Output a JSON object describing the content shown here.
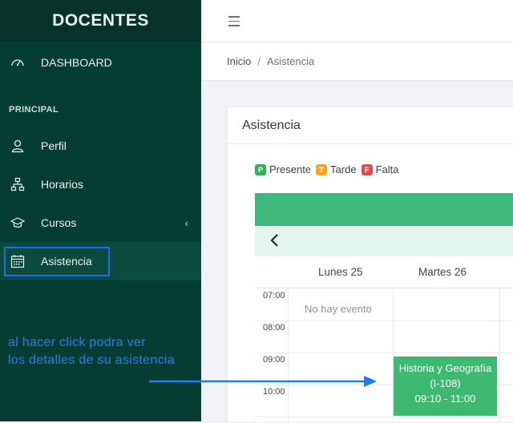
{
  "sidebar": {
    "brand": "DOCENTES",
    "dashboard": "DASHBOARD",
    "section": "PRINCIPAL",
    "items": [
      {
        "label": "Perfil",
        "icon": "user-icon"
      },
      {
        "label": "Horarios",
        "icon": "sitemap-icon"
      },
      {
        "label": "Cursos",
        "icon": "graduation-cap-icon"
      },
      {
        "label": "Asistencia",
        "icon": "calendar-icon"
      }
    ],
    "chevron": "‹"
  },
  "annotation": {
    "line1": "al hacer click podra ver",
    "line2": "los detalles de su asistencia"
  },
  "breadcrumb": {
    "home": "Inicio",
    "sep": "/",
    "current": "Asistencia"
  },
  "card": {
    "title": "Asistencia",
    "legend": [
      {
        "badge": "P",
        "label": "Presente",
        "color": "#2fb15a"
      },
      {
        "badge": "T",
        "label": "Tarde",
        "color": "#f5a623"
      },
      {
        "badge": "F",
        "label": "Falta",
        "color": "#e8494e"
      }
    ]
  },
  "calendar": {
    "prev": "‹",
    "days": [
      "Lunes 25",
      "Martes 26"
    ],
    "times": [
      "07:00",
      "08:00",
      "09:00",
      "10:00"
    ],
    "no_event": "No hay evento",
    "event": {
      "title": "Historia y Geografía",
      "room": "(I-108)",
      "time": "09:10 - 11:00"
    }
  },
  "colors": {
    "sidebar": "#063d32",
    "accent": "#3fba7f",
    "annotation": "#1e7cf5"
  }
}
